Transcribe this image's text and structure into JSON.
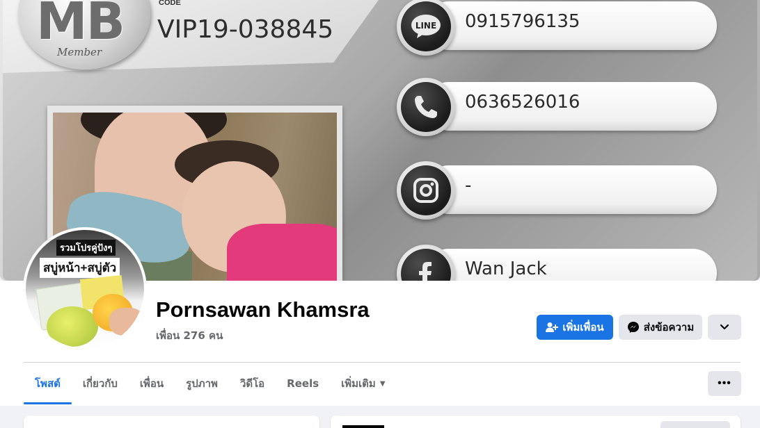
{
  "cover": {
    "badge_text": "MB",
    "badge_sub": "Member",
    "code_label": "CODE",
    "code_value": "VIP19-038845",
    "contacts": [
      {
        "icon": "line-icon",
        "label": "LINE",
        "value": "0915796135"
      },
      {
        "icon": "phone-icon",
        "value": "0636526016"
      },
      {
        "icon": "instagram-icon",
        "value": "-"
      },
      {
        "icon": "facebook-icon",
        "value": "Wan Jack"
      }
    ]
  },
  "avatar": {
    "tag1": "รวมโปรคู่ปังๆ",
    "tag2": "สบู่หน้า+สบู่ตัว"
  },
  "profile": {
    "name": "Pornsawan Khamsra",
    "friends": "เพื่อน 276 คน"
  },
  "actions": {
    "add_friend": "เพิ่มเพื่อน",
    "message": "ส่งข้อความ"
  },
  "tabs": [
    {
      "label": "โพสต์",
      "active": true
    },
    {
      "label": "เกี่ยวกับ"
    },
    {
      "label": "เพื่อน"
    },
    {
      "label": "รูปภาพ"
    },
    {
      "label": "วิดีโอ"
    },
    {
      "label": "Reels"
    },
    {
      "label": "เพิ่มเติม"
    }
  ],
  "colors": {
    "accent": "#1b74e4",
    "button_gray": "#e4e6eb",
    "text_secondary": "#65676b"
  }
}
